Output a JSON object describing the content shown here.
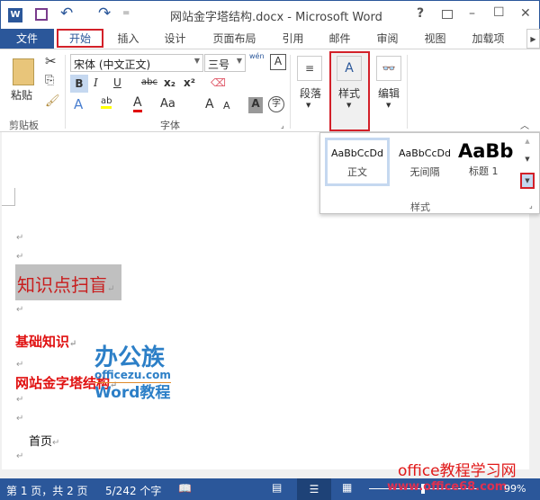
{
  "titlebar": {
    "title": "网站金字塔结构.docx - Microsoft Word",
    "help": "?",
    "minimize": "–",
    "maximize": "☐",
    "close": "✕",
    "undo": "↶",
    "redo": "↷",
    "qa": "="
  },
  "tabs": [
    "文件",
    "开始",
    "插入",
    "设计",
    "页面布局",
    "引用",
    "邮件",
    "审阅",
    "视图",
    "加载项"
  ],
  "ribbon": {
    "clipboard": {
      "paste": "粘贴",
      "group": "剪贴板"
    },
    "font": {
      "name": "宋体 (中文正文)",
      "size": "三号",
      "group": "字体",
      "bold": "B",
      "italic": "I",
      "underline": "U",
      "strike": "abc",
      "sub": "x₂",
      "sup": "x²",
      "effects": "A",
      "highlight": "ab",
      "color": "A",
      "case": "Aa",
      "grow": "A",
      "shrink": "A",
      "shade": "A",
      "enclose": "字",
      "phonetic": "wén",
      "border": "A"
    },
    "paragraph": "段落",
    "styles": "样式",
    "editing": "编辑"
  },
  "styles_panel": {
    "items": [
      {
        "preview": "AaBbCcDd",
        "name": "正文"
      },
      {
        "preview": "AaBbCcDd",
        "name": "无间隔"
      },
      {
        "preview": "AaBb",
        "name": "标题 1"
      }
    ],
    "group": "样式"
  },
  "document": {
    "lines": [
      "知识点扫盲",
      "基础知识",
      "网站金字塔结构",
      "首页"
    ],
    "para_mark": "↵"
  },
  "watermark": {
    "logo": "办公族",
    "site": "officezu.com",
    "sub": "Word教程",
    "brand": "office教程学习网",
    "url": "www.office68.com"
  },
  "status": {
    "page": "第 1 页，共 2 页",
    "words": "5/242 个字",
    "zoom": "99%"
  },
  "colors": {
    "accent": "#2b579a",
    "highlight_red": "#d32029",
    "heading_red": "#e01010"
  }
}
